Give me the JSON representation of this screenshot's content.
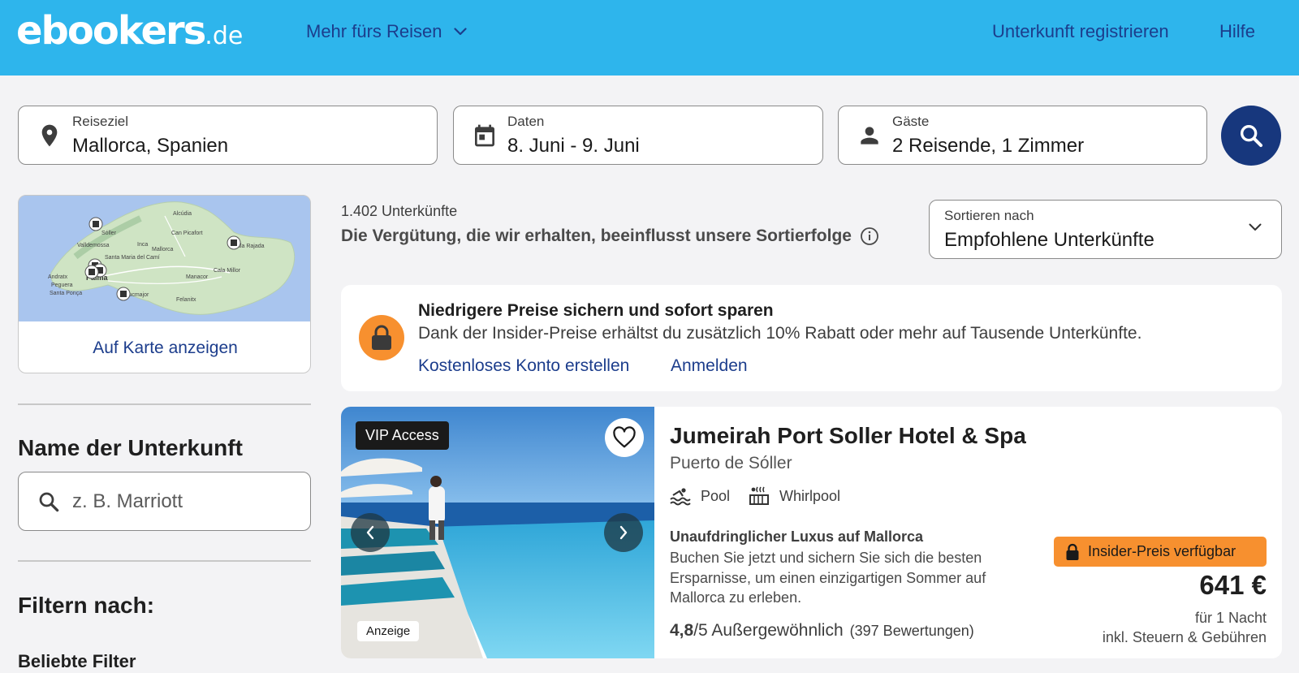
{
  "header": {
    "logo_main": "ebookers",
    "logo_tld": ".de",
    "nav_more": "Mehr fürs Reisen",
    "register_link": "Unterkunft registrieren",
    "help_link": "Hilfe"
  },
  "search": {
    "destination_label": "Reiseziel",
    "destination_value": "Mallorca, Spanien",
    "dates_label": "Daten",
    "dates_value": "8. Juni - 9. Juni",
    "guests_label": "Gäste",
    "guests_value": "2 Reisende, 1 Zimmer"
  },
  "map": {
    "show_on_map": "Auf Karte anzeigen",
    "places": [
      "Alcúdia",
      "Sóller",
      "Valldemossa",
      "Inca",
      "Can Picafort",
      "Mallorca",
      "Santa Maria del Camí",
      "Palma",
      "Andratx",
      "Peguera",
      "Santa Ponça",
      "Manacor",
      "Cala Millor",
      "Llucmajor",
      "Felanitx",
      "Cala Rajada"
    ]
  },
  "sidebar": {
    "name_title": "Name der Unterkunft",
    "name_placeholder": "z. B. Marriott",
    "filter_title": "Filtern nach:",
    "popular_filters": "Beliebte Filter"
  },
  "results": {
    "count": "1.402 Unterkünfte",
    "disclaimer": "Die Vergütung, die wir erhalten, beeinflusst unsere Sortierfolge",
    "sort_label": "Sortieren nach",
    "sort_value": "Empfohlene Unterkünfte"
  },
  "banner": {
    "title": "Niedrigere Preise sichern und sofort sparen",
    "text": "Dank der Insider-Preise erhältst du zusätzlich 10% Rabatt oder mehr auf Tausende Unterkünfte.",
    "create_account": "Kostenloses Konto erstellen",
    "sign_in": "Anmelden"
  },
  "hotel": {
    "vip_badge": "VIP Access",
    "ad_label": "Anzeige",
    "name": "Jumeirah Port Soller Hotel & Spa",
    "location": "Puerto de Sóller",
    "amenity_1": "Pool",
    "amenity_2": "Whirlpool",
    "tagline": "Unaufdringlicher Luxus auf Mallorca",
    "description": "Buchen Sie jetzt und sichern Sie sich die besten Ersparnisse, um einen einzigartigen Sommer auf Mallorca zu erleben.",
    "rating_value": "4,8",
    "rating_scale": "/5 Außergewöhnlich",
    "review_count": "(397 Bewertungen)",
    "insider_badge": "Insider-Preis verfügbar",
    "price": "641 €",
    "price_period": "für 1 Nacht",
    "price_note": "inkl. Steuern & Gebühren"
  },
  "colors": {
    "header_bg": "#2eb5ec",
    "link_blue": "#1c3d8c",
    "search_button": "#17377d",
    "insider_orange": "#f7902f"
  }
}
